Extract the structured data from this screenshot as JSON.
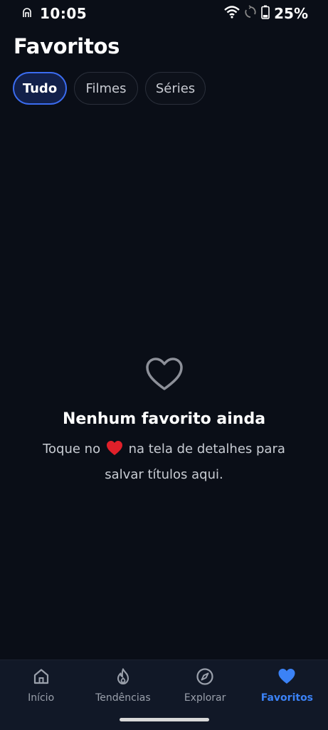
{
  "status_bar": {
    "time": "10:05",
    "battery": "25%",
    "icons": [
      "accessibility-icon",
      "wifi-icon",
      "sync-icon",
      "battery-icon"
    ]
  },
  "page": {
    "title": "Favoritos"
  },
  "filters": {
    "selected": "Tudo",
    "chips": [
      {
        "label": "Tudo",
        "active": true
      },
      {
        "label": "Filmes",
        "active": false
      },
      {
        "label": "Séries",
        "active": false
      }
    ]
  },
  "empty_state": {
    "icon": "heart-outline-icon",
    "title": "Nenhum favorito ainda",
    "text_before": "Toque no",
    "text_after": "na tela de detalhes para",
    "text_line2": "salvar títulos aqui.",
    "heart_color": "#e0202a"
  },
  "bottom_nav": {
    "items": [
      {
        "label": "Início",
        "icon": "home-icon",
        "active": false
      },
      {
        "label": "Tendências",
        "icon": "flame-icon",
        "active": false
      },
      {
        "label": "Explorar",
        "icon": "compass-icon",
        "active": false
      },
      {
        "label": "Favoritos",
        "icon": "heart-icon",
        "active": true
      }
    ]
  },
  "colors": {
    "background": "#0a0e17",
    "accent": "#3b82f6",
    "chip_active_border": "#3b6cf0",
    "nav_background": "#111827"
  }
}
